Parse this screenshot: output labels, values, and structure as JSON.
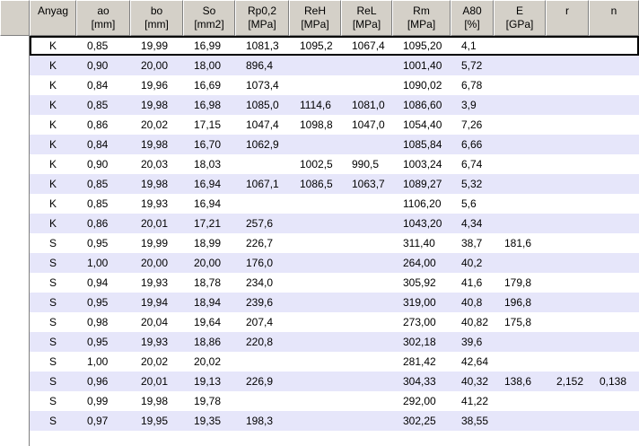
{
  "columns": [
    {
      "l1": "Anyag",
      "l2": ""
    },
    {
      "l1": "ao",
      "l2": "[mm]"
    },
    {
      "l1": "bo",
      "l2": "[mm]"
    },
    {
      "l1": "So",
      "l2": "[mm2]"
    },
    {
      "l1": "Rp0,2",
      "l2": "[MPa]"
    },
    {
      "l1": "ReH",
      "l2": "[MPa]"
    },
    {
      "l1": "ReL",
      "l2": "[MPa]"
    },
    {
      "l1": "Rm",
      "l2": "[MPa]"
    },
    {
      "l1": "A80",
      "l2": "[%]"
    },
    {
      "l1": "E",
      "l2": "[GPa]"
    },
    {
      "l1": "r",
      "l2": ""
    },
    {
      "l1": "n",
      "l2": ""
    }
  ],
  "rows": [
    [
      "K",
      "0,85",
      "19,99",
      "16,99",
      "1081,3",
      "1095,2",
      "1067,4",
      "1095,20",
      "4,1",
      "",
      "",
      ""
    ],
    [
      "K",
      "0,90",
      "20,00",
      "18,00",
      "896,4",
      "",
      "",
      "1001,40",
      "5,72",
      "",
      "",
      ""
    ],
    [
      "K",
      "0,84",
      "19,96",
      "16,69",
      "1073,4",
      "",
      "",
      "1090,02",
      "6,78",
      "",
      "",
      ""
    ],
    [
      "K",
      "0,85",
      "19,98",
      "16,98",
      "1085,0",
      "1114,6",
      "1081,0",
      "1086,60",
      "3,9",
      "",
      "",
      ""
    ],
    [
      "K",
      "0,86",
      "20,02",
      "17,15",
      "1047,4",
      "1098,8",
      "1047,0",
      "1054,40",
      "7,26",
      "",
      "",
      ""
    ],
    [
      "K",
      "0,84",
      "19,98",
      "16,70",
      "1062,9",
      "",
      "",
      "1085,84",
      "6,66",
      "",
      "",
      ""
    ],
    [
      "K",
      "0,90",
      "20,03",
      "18,03",
      "",
      "1002,5",
      "990,5",
      "1003,24",
      "6,74",
      "",
      "",
      ""
    ],
    [
      "K",
      "0,85",
      "19,98",
      "16,94",
      "1067,1",
      "1086,5",
      "1063,7",
      "1089,27",
      "5,32",
      "",
      "",
      ""
    ],
    [
      "K",
      "0,85",
      "19,93",
      "16,94",
      "",
      "",
      "",
      "1106,20",
      "5,6",
      "",
      "",
      ""
    ],
    [
      "K",
      "0,86",
      "20,01",
      "17,21",
      "257,6",
      "",
      "",
      "1043,20",
      "4,34",
      "",
      "",
      ""
    ],
    [
      "S",
      "0,95",
      "19,99",
      "18,99",
      "226,7",
      "",
      "",
      "311,40",
      "38,7",
      "181,6",
      "",
      ""
    ],
    [
      "S",
      "1,00",
      "20,00",
      "20,00",
      "176,0",
      "",
      "",
      "264,00",
      "40,2",
      "",
      "",
      ""
    ],
    [
      "S",
      "0,94",
      "19,93",
      "18,78",
      "234,0",
      "",
      "",
      "305,92",
      "41,6",
      "179,8",
      "",
      ""
    ],
    [
      "S",
      "0,95",
      "19,94",
      "18,94",
      "239,6",
      "",
      "",
      "319,00",
      "40,8",
      "196,8",
      "",
      ""
    ],
    [
      "S",
      "0,98",
      "20,04",
      "19,64",
      "207,4",
      "",
      "",
      "273,00",
      "40,82",
      "175,8",
      "",
      ""
    ],
    [
      "S",
      "0,95",
      "19,93",
      "18,86",
      "220,8",
      "",
      "",
      "302,18",
      "39,6",
      "",
      "",
      ""
    ],
    [
      "S",
      "1,00",
      "20,02",
      "20,02",
      "",
      "",
      "",
      "281,42",
      "42,64",
      "",
      "",
      ""
    ],
    [
      "S",
      "0,96",
      "20,01",
      "19,13",
      "226,9",
      "",
      "",
      "304,33",
      "40,32",
      "138,6",
      "2,152",
      "0,138"
    ],
    [
      "S",
      "0,99",
      "19,98",
      "19,78",
      "",
      "",
      "",
      "292,00",
      "41,22",
      "",
      "",
      ""
    ],
    [
      "S",
      "0,97",
      "19,95",
      "19,35",
      "198,3",
      "",
      "",
      "302,25",
      "38,55",
      "",
      "",
      ""
    ]
  ]
}
